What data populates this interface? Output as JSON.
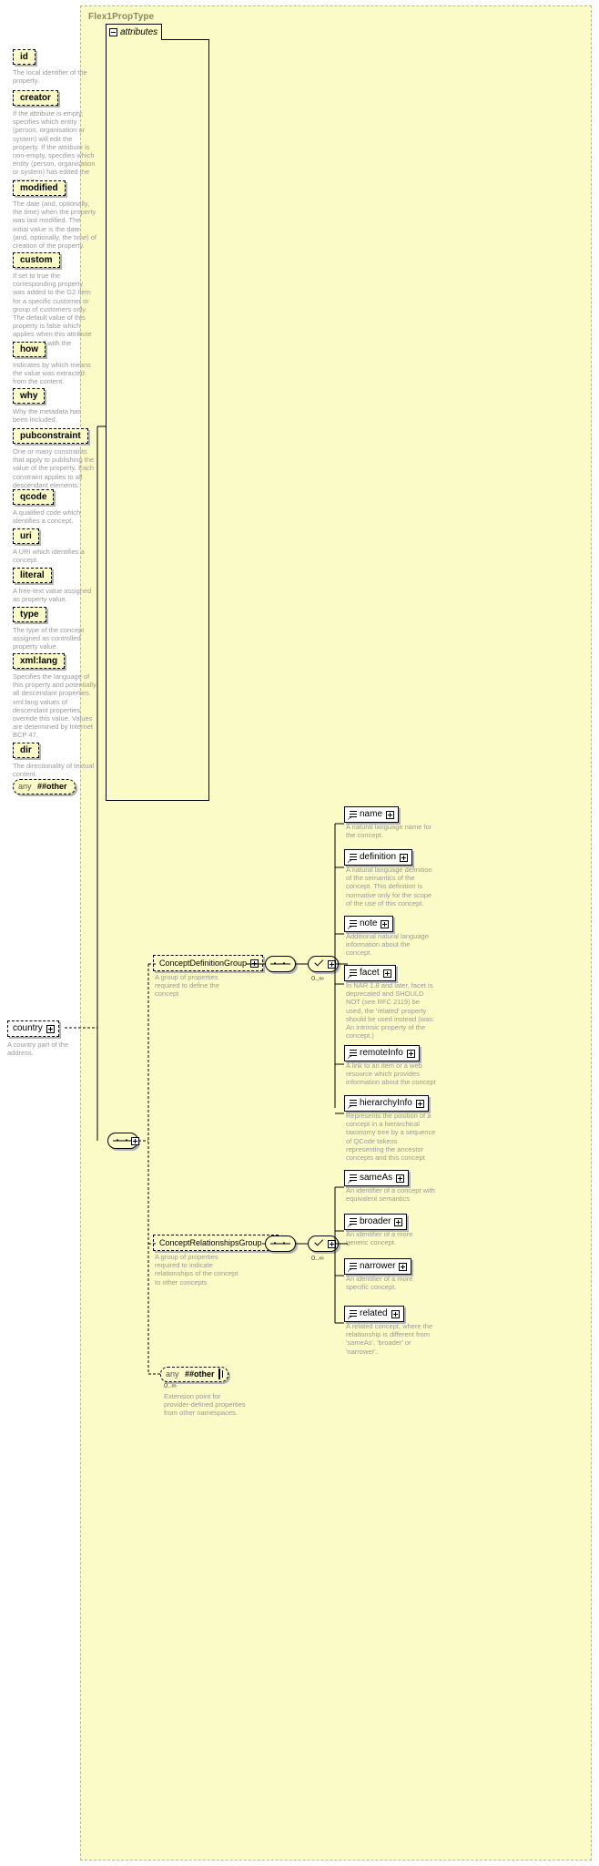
{
  "diagram": {
    "type_name": "Flex1PropType",
    "attributes_label": "attributes",
    "colors": {
      "panel_background": "#fbfbc8",
      "panel_border": "#b9b98e",
      "description_text": "#9a9a9a",
      "box_shadow": "#b3b3b3"
    }
  },
  "attributes": [
    {
      "name": "id",
      "description": "The local identifier of the property."
    },
    {
      "name": "creator",
      "description": "If the attribute is empty, specifies which entity (person, organisation or system) will edit the property. If the attribute is non-empty, specifies which entity (person, organisation or system) has edited the property."
    },
    {
      "name": "modified",
      "description": "The date (and, optionally, the time) when the property was last modified. The initial value is the date (and, optionally, the time) of creation of the property."
    },
    {
      "name": "custom",
      "description": "If set to true the corresponding property was added to the G2 Item for a specific customer or group of customers only. The default value of this property is false which applies when this attribute is not used with the property."
    },
    {
      "name": "how",
      "description": "Indicates by which means the value was extracted from the content."
    },
    {
      "name": "why",
      "description": "Why the metadata has been included."
    },
    {
      "name": "pubconstraint",
      "description": "One or many constraints that apply to publishing the value of the property. Each constraint applies to all descendant elements."
    },
    {
      "name": "qcode",
      "description": "A qualified code which identifies a concept."
    },
    {
      "name": "uri",
      "description": "A URI which identifies a concept."
    },
    {
      "name": "literal",
      "description": "A free-text value assigned as property value."
    },
    {
      "name": "type",
      "description": "The type of the concept assigned as controlled property value."
    },
    {
      "name": "xml:lang",
      "description": "Specifies the language of this property and potentially all descendant properties. xml:lang values of descendant properties override this value. Values are determined by Internet BCP 47."
    },
    {
      "name": "dir",
      "description": "The directionality of textual content."
    }
  ],
  "attributes_any": {
    "any_label": "any",
    "namespace_label": "##other"
  },
  "country_element": {
    "name": "country",
    "description": "A country part of the address."
  },
  "groups": [
    {
      "name": "ConceptDefinitionGroup",
      "description": "A group of properties required to define the concept",
      "occurs": "0..∞",
      "members": [
        {
          "name": "name",
          "description": "A natural language name for the concept."
        },
        {
          "name": "definition",
          "description": "A natural language definition of the semantics of the concept. This definition is normative only for the scope of the use of this concept."
        },
        {
          "name": "note",
          "description": "Additional natural language information about the concept."
        },
        {
          "name": "facet",
          "description": "In NAR 1.8 and later, facet is deprecated and SHOULD NOT (see RFC 2119) be used, the 'related' property should be used instead (was: An intrinsic property of the concept.)"
        },
        {
          "name": "remoteInfo",
          "description": "A link to an item or a web resource which provides information about the concept"
        },
        {
          "name": "hierarchyInfo",
          "description": "Represents the position of a concept in a hierarchical taxonomy tree by a sequence of QCode tokens representing the ancestor concepts and this concept"
        }
      ]
    },
    {
      "name": "ConceptRelationshipsGroup",
      "description": "A group of properties required to indicate relationships of the concept to other concepts",
      "occurs": "0..∞",
      "members": [
        {
          "name": "sameAs",
          "description": "An identifier of a concept with equivalent semantics"
        },
        {
          "name": "broader",
          "description": "An identifier of a more generic concept."
        },
        {
          "name": "narrower",
          "description": "An identifier of a more specific concept."
        },
        {
          "name": "related",
          "description": "A related concept, where the relationship is different from 'sameAs', 'broader' or 'narrower'."
        }
      ]
    }
  ],
  "extension_point": {
    "any_label": "any",
    "namespace_label": "##other",
    "occurs": "0..∞",
    "description": "Extension point for provider-defined properties from other namespaces."
  }
}
